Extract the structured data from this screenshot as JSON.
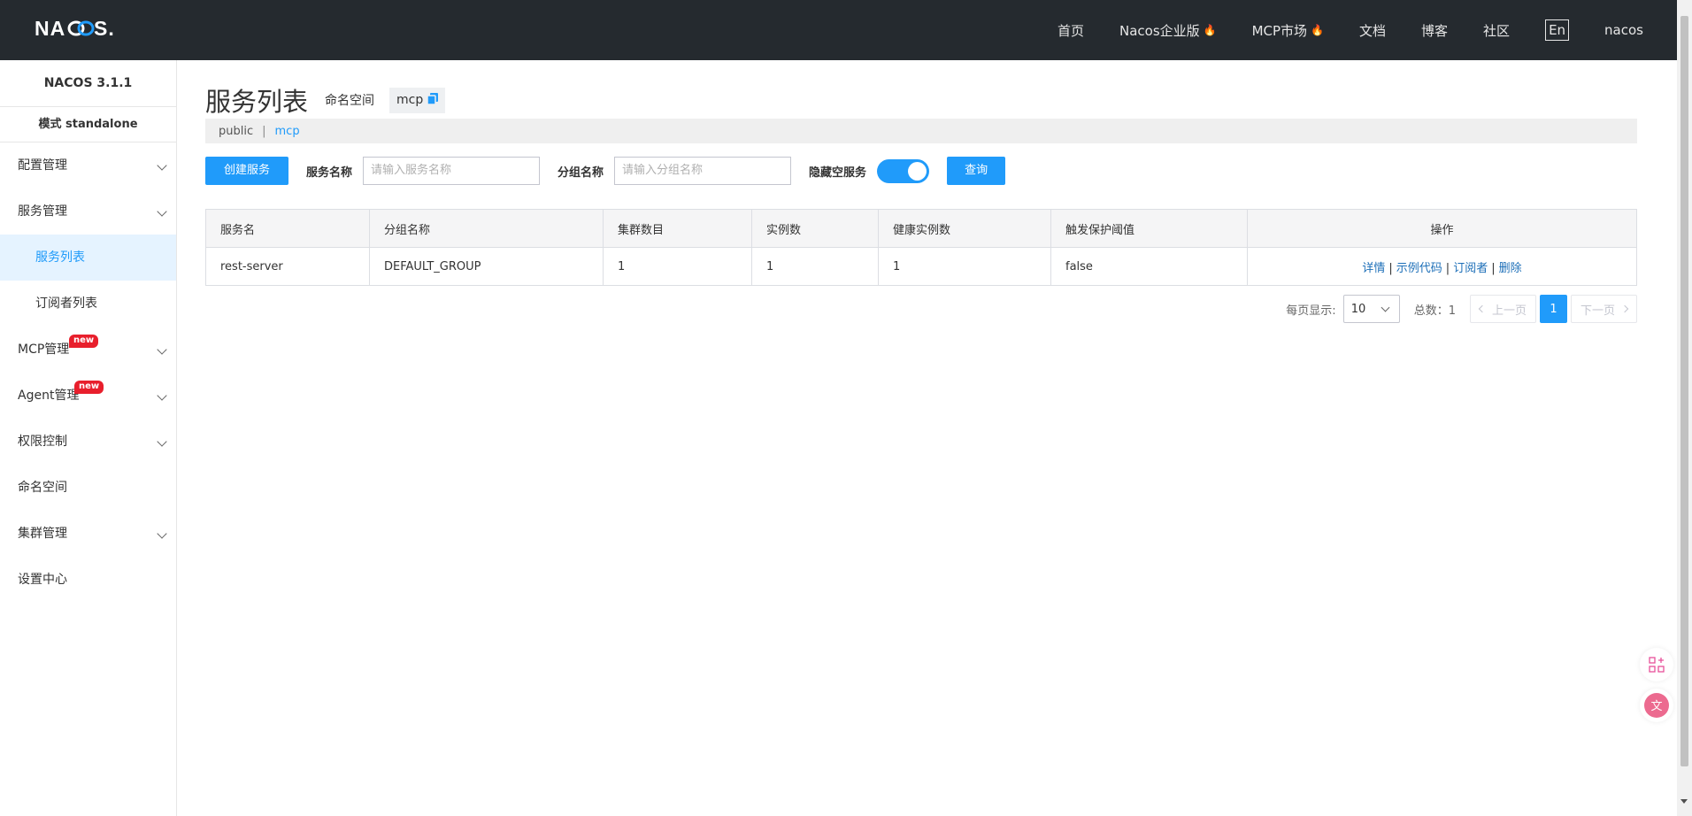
{
  "header": {
    "logo": "NACOS.",
    "nav": [
      {
        "label": "首页",
        "hot": false
      },
      {
        "label": "Nacos企业版",
        "hot": true
      },
      {
        "label": "MCP市场",
        "hot": true
      },
      {
        "label": "文档",
        "hot": false
      },
      {
        "label": "博客",
        "hot": false
      },
      {
        "label": "社区",
        "hot": false
      }
    ],
    "lang": "En",
    "user": "nacos"
  },
  "sidebar": {
    "version": "NACOS 3.1.1",
    "mode": "模式 standalone",
    "items": [
      {
        "label": "配置管理"
      },
      {
        "label": "服务管理"
      },
      {
        "label": "服务列表"
      },
      {
        "label": "订阅者列表"
      },
      {
        "label": "MCP管理",
        "badge": "new"
      },
      {
        "label": "Agent管理",
        "badge": "new"
      },
      {
        "label": "权限控制"
      },
      {
        "label": "命名空间"
      },
      {
        "label": "集群管理"
      },
      {
        "label": "设置中心"
      }
    ]
  },
  "main": {
    "title": "服务列表",
    "namespace_label": "命名空间",
    "namespace_value": "mcp",
    "ns_bar": {
      "public": "public",
      "sep": "|",
      "current": "mcp"
    },
    "toolbar": {
      "create_label": "创建服务",
      "service_name_label": "服务名称",
      "service_name_placeholder": "请输入服务名称",
      "group_name_label": "分组名称",
      "group_name_placeholder": "请输入分组名称",
      "hide_empty_label": "隐藏空服务",
      "hide_empty_on": true,
      "query_label": "查询"
    },
    "table": {
      "columns": [
        "服务名",
        "分组名称",
        "集群数目",
        "实例数",
        "健康实例数",
        "触发保护阈值",
        "操作"
      ],
      "rows": [
        {
          "service": "rest-server",
          "group": "DEFAULT_GROUP",
          "clusters": "1",
          "instances": "1",
          "healthy": "1",
          "protect": "false"
        }
      ],
      "ops": [
        "详情",
        "示例代码",
        "订阅者",
        "删除"
      ],
      "op_sep": "|"
    },
    "pager": {
      "page_size_label": "每页显示:",
      "page_size": "10",
      "total": "总数：1",
      "prev": "上一页",
      "current": "1",
      "next": "下一页"
    }
  },
  "colors": {
    "accent": "#209bfa",
    "header_bg": "#252a2f",
    "badge": "#e81f2c"
  }
}
